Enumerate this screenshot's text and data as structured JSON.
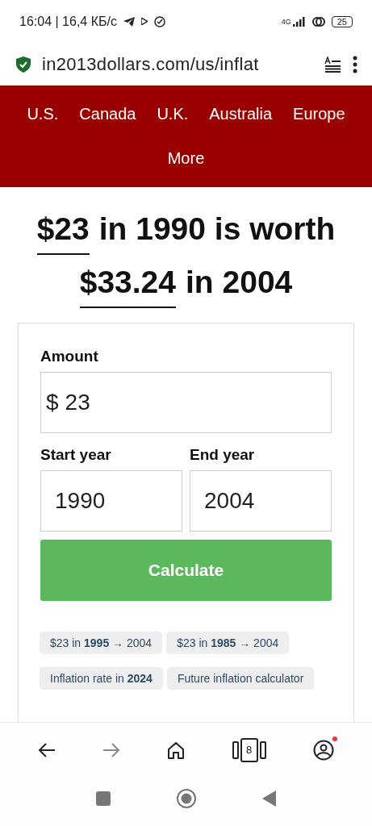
{
  "status_bar": {
    "time": "16:04 | 16,4 КБ/с",
    "network": "4G",
    "battery": "25"
  },
  "address_bar": {
    "url": "in2013dollars.com/us/inflat"
  },
  "nav": {
    "items": [
      "U.S.",
      "Canada",
      "U.K.",
      "Australia",
      "Europe",
      "More"
    ]
  },
  "headline": {
    "lines": [
      [
        {
          "text": "$23",
          "underlined": true
        },
        {
          "text": "in 1990 is worth",
          "underlined": false
        }
      ],
      [
        {
          "text": "$33.24",
          "underlined": true
        },
        {
          "text": "in 2004",
          "underlined": false
        }
      ]
    ]
  },
  "form": {
    "amount_label": "Amount",
    "currency": "$",
    "amount": "23",
    "start_label": "Start year",
    "start_year": "1990",
    "end_label": "End year",
    "end_year": "2004",
    "button": "Calculate"
  },
  "links": [
    "$23 in **1995** → 2004",
    "$23 in **1985** → 2004",
    "Inflation rate in **2024**",
    "Future inflation calculator"
  ],
  "browser_bar": {
    "forward_disabled": true,
    "tabs_count": "8",
    "notification": true
  }
}
